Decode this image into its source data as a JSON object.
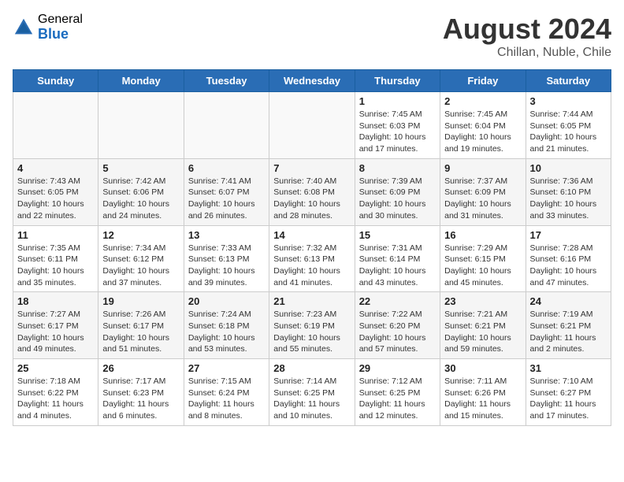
{
  "header": {
    "logo_general": "General",
    "logo_blue": "Blue",
    "month_year": "August 2024",
    "location": "Chillan, Nuble, Chile"
  },
  "days_of_week": [
    "Sunday",
    "Monday",
    "Tuesday",
    "Wednesday",
    "Thursday",
    "Friday",
    "Saturday"
  ],
  "weeks": [
    [
      {
        "day": "",
        "info": ""
      },
      {
        "day": "",
        "info": ""
      },
      {
        "day": "",
        "info": ""
      },
      {
        "day": "",
        "info": ""
      },
      {
        "day": "1",
        "info": "Sunrise: 7:45 AM\nSunset: 6:03 PM\nDaylight: 10 hours and 17 minutes."
      },
      {
        "day": "2",
        "info": "Sunrise: 7:45 AM\nSunset: 6:04 PM\nDaylight: 10 hours and 19 minutes."
      },
      {
        "day": "3",
        "info": "Sunrise: 7:44 AM\nSunset: 6:05 PM\nDaylight: 10 hours and 21 minutes."
      }
    ],
    [
      {
        "day": "4",
        "info": "Sunrise: 7:43 AM\nSunset: 6:05 PM\nDaylight: 10 hours and 22 minutes."
      },
      {
        "day": "5",
        "info": "Sunrise: 7:42 AM\nSunset: 6:06 PM\nDaylight: 10 hours and 24 minutes."
      },
      {
        "day": "6",
        "info": "Sunrise: 7:41 AM\nSunset: 6:07 PM\nDaylight: 10 hours and 26 minutes."
      },
      {
        "day": "7",
        "info": "Sunrise: 7:40 AM\nSunset: 6:08 PM\nDaylight: 10 hours and 28 minutes."
      },
      {
        "day": "8",
        "info": "Sunrise: 7:39 AM\nSunset: 6:09 PM\nDaylight: 10 hours and 30 minutes."
      },
      {
        "day": "9",
        "info": "Sunrise: 7:37 AM\nSunset: 6:09 PM\nDaylight: 10 hours and 31 minutes."
      },
      {
        "day": "10",
        "info": "Sunrise: 7:36 AM\nSunset: 6:10 PM\nDaylight: 10 hours and 33 minutes."
      }
    ],
    [
      {
        "day": "11",
        "info": "Sunrise: 7:35 AM\nSunset: 6:11 PM\nDaylight: 10 hours and 35 minutes."
      },
      {
        "day": "12",
        "info": "Sunrise: 7:34 AM\nSunset: 6:12 PM\nDaylight: 10 hours and 37 minutes."
      },
      {
        "day": "13",
        "info": "Sunrise: 7:33 AM\nSunset: 6:13 PM\nDaylight: 10 hours and 39 minutes."
      },
      {
        "day": "14",
        "info": "Sunrise: 7:32 AM\nSunset: 6:13 PM\nDaylight: 10 hours and 41 minutes."
      },
      {
        "day": "15",
        "info": "Sunrise: 7:31 AM\nSunset: 6:14 PM\nDaylight: 10 hours and 43 minutes."
      },
      {
        "day": "16",
        "info": "Sunrise: 7:29 AM\nSunset: 6:15 PM\nDaylight: 10 hours and 45 minutes."
      },
      {
        "day": "17",
        "info": "Sunrise: 7:28 AM\nSunset: 6:16 PM\nDaylight: 10 hours and 47 minutes."
      }
    ],
    [
      {
        "day": "18",
        "info": "Sunrise: 7:27 AM\nSunset: 6:17 PM\nDaylight: 10 hours and 49 minutes."
      },
      {
        "day": "19",
        "info": "Sunrise: 7:26 AM\nSunset: 6:17 PM\nDaylight: 10 hours and 51 minutes."
      },
      {
        "day": "20",
        "info": "Sunrise: 7:24 AM\nSunset: 6:18 PM\nDaylight: 10 hours and 53 minutes."
      },
      {
        "day": "21",
        "info": "Sunrise: 7:23 AM\nSunset: 6:19 PM\nDaylight: 10 hours and 55 minutes."
      },
      {
        "day": "22",
        "info": "Sunrise: 7:22 AM\nSunset: 6:20 PM\nDaylight: 10 hours and 57 minutes."
      },
      {
        "day": "23",
        "info": "Sunrise: 7:21 AM\nSunset: 6:21 PM\nDaylight: 10 hours and 59 minutes."
      },
      {
        "day": "24",
        "info": "Sunrise: 7:19 AM\nSunset: 6:21 PM\nDaylight: 11 hours and 2 minutes."
      }
    ],
    [
      {
        "day": "25",
        "info": "Sunrise: 7:18 AM\nSunset: 6:22 PM\nDaylight: 11 hours and 4 minutes."
      },
      {
        "day": "26",
        "info": "Sunrise: 7:17 AM\nSunset: 6:23 PM\nDaylight: 11 hours and 6 minutes."
      },
      {
        "day": "27",
        "info": "Sunrise: 7:15 AM\nSunset: 6:24 PM\nDaylight: 11 hours and 8 minutes."
      },
      {
        "day": "28",
        "info": "Sunrise: 7:14 AM\nSunset: 6:25 PM\nDaylight: 11 hours and 10 minutes."
      },
      {
        "day": "29",
        "info": "Sunrise: 7:12 AM\nSunset: 6:25 PM\nDaylight: 11 hours and 12 minutes."
      },
      {
        "day": "30",
        "info": "Sunrise: 7:11 AM\nSunset: 6:26 PM\nDaylight: 11 hours and 15 minutes."
      },
      {
        "day": "31",
        "info": "Sunrise: 7:10 AM\nSunset: 6:27 PM\nDaylight: 11 hours and 17 minutes."
      }
    ]
  ]
}
